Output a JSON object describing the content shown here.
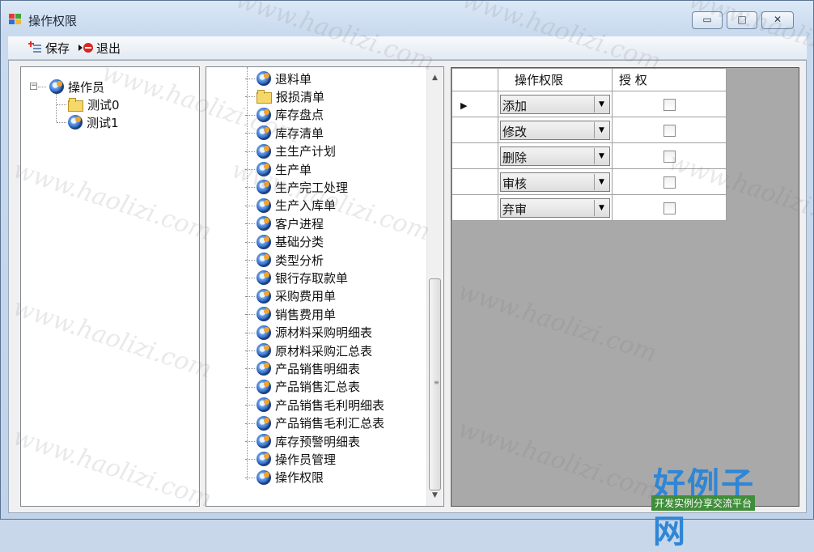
{
  "window": {
    "title": "操作权限",
    "controls": {
      "minimize": "▭",
      "maximize": "□",
      "close": "✕"
    }
  },
  "toolbar": {
    "save_label": "保存",
    "exit_label": "退出"
  },
  "role_tree": {
    "root_label": "操作员",
    "children": [
      "测试0",
      "测试1"
    ]
  },
  "menu_tree": {
    "items": [
      "退料单",
      "报损清单",
      "库存盘点",
      "库存清单",
      "主生产计划",
      "生产单",
      "生产完工处理",
      "生产入库单",
      "客户进程",
      "基础分类",
      "类型分析",
      "银行存取款单",
      "采购费用单",
      "销售费用单",
      "源材料采购明细表",
      "原材料采购汇总表",
      "产品销售明细表",
      "产品销售汇总表",
      "产品销售毛利明细表",
      "产品销售毛利汇总表",
      "库存预警明细表",
      "操作员管理",
      "操作权限"
    ],
    "folder_items": [
      1
    ]
  },
  "grid": {
    "headers": {
      "permission": "操作权限",
      "grant": "授  权"
    },
    "rows": [
      {
        "permission": "添加",
        "granted": false,
        "current": true
      },
      {
        "permission": "修改",
        "granted": false,
        "current": false
      },
      {
        "permission": "删除",
        "granted": false,
        "current": false
      },
      {
        "permission": "审核",
        "granted": false,
        "current": false
      },
      {
        "permission": "弃审",
        "granted": false,
        "current": false
      }
    ]
  },
  "watermark": {
    "text": "www.haolizi.com",
    "logo_big": "好例子网",
    "logo_small": "开发实例分享交流平台"
  },
  "colors": {
    "accent": "#2f86d6",
    "logo_band": "#3f8e3a",
    "grid_bg": "#a9a9a9"
  }
}
